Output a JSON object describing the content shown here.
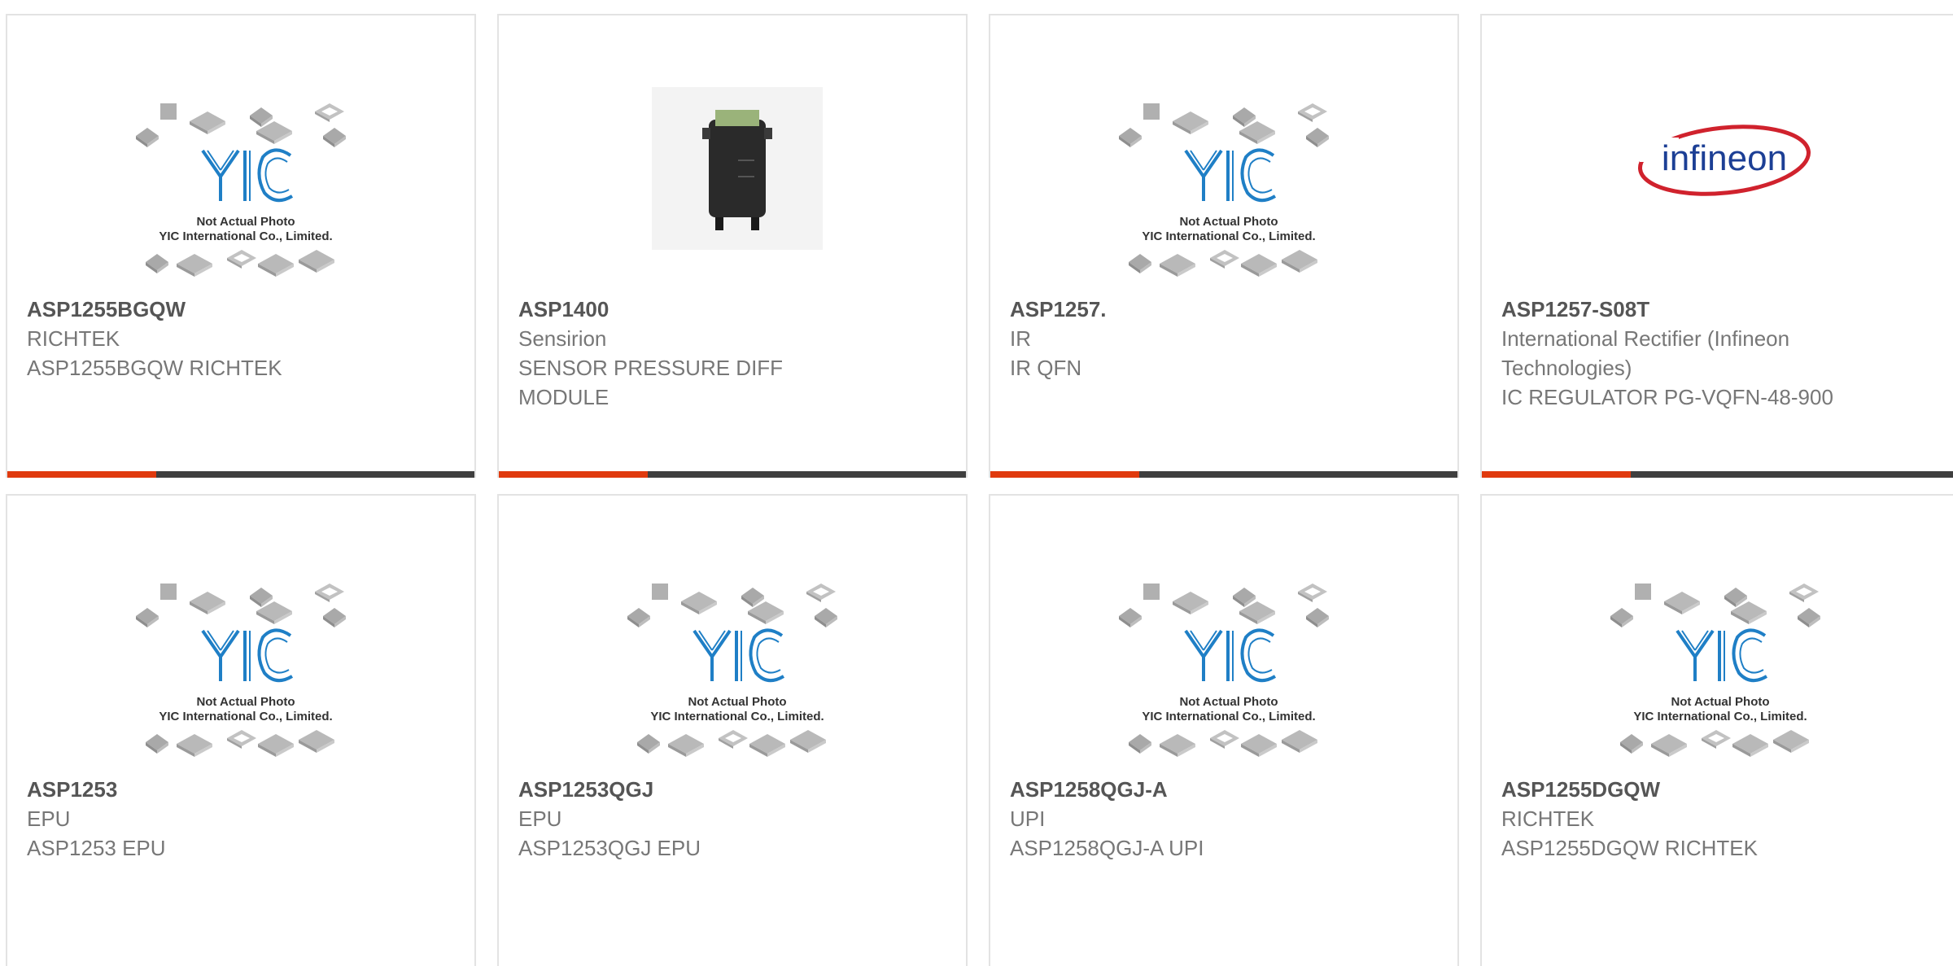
{
  "colors": {
    "accent": "#e03a0e",
    "bar": "#3f3f3f",
    "card_border": "#e3e3e3",
    "part_number": "#555555",
    "text": "#777777",
    "yic_logo": "#1f7fc6",
    "infineon_red": "#d0222d",
    "infineon_blue": "#1c3f95"
  },
  "placeholder": {
    "logo_text": "YIC",
    "line1": "Not Actual Photo",
    "line2": "YIC International Co., Limited."
  },
  "brand_logo_text": "infineon",
  "products": [
    {
      "part_number": "ASP1255BGQW",
      "manufacturer": "RICHTEK",
      "description": "ASP1255BGQW RICHTEK",
      "image": "yic-placeholder"
    },
    {
      "part_number": "ASP1400",
      "manufacturer": "Sensirion",
      "description": "SENSOR PRESSURE DIFF MODULE",
      "image": "sensor-module-photo"
    },
    {
      "part_number": "ASP1257.",
      "manufacturer": "IR",
      "description": "IR QFN",
      "image": "yic-placeholder"
    },
    {
      "part_number": "ASP1257-S08T",
      "manufacturer": "International Rectifier (Infineon Technologies)",
      "description": "IC REGULATOR PG-VQFN-48-900",
      "image": "infineon-logo"
    },
    {
      "part_number": "ASP1253",
      "manufacturer": "EPU",
      "description": "ASP1253 EPU",
      "image": "yic-placeholder"
    },
    {
      "part_number": "ASP1253QGJ",
      "manufacturer": "EPU",
      "description": "ASP1253QGJ EPU",
      "image": "yic-placeholder"
    },
    {
      "part_number": "ASP1258QGJ-A",
      "manufacturer": "UPI",
      "description": "ASP1258QGJ-A UPI",
      "image": "yic-placeholder"
    },
    {
      "part_number": "ASP1255DGQW",
      "manufacturer": "RICHTEK",
      "description": "ASP1255DGQW RICHTEK",
      "image": "yic-placeholder"
    }
  ]
}
